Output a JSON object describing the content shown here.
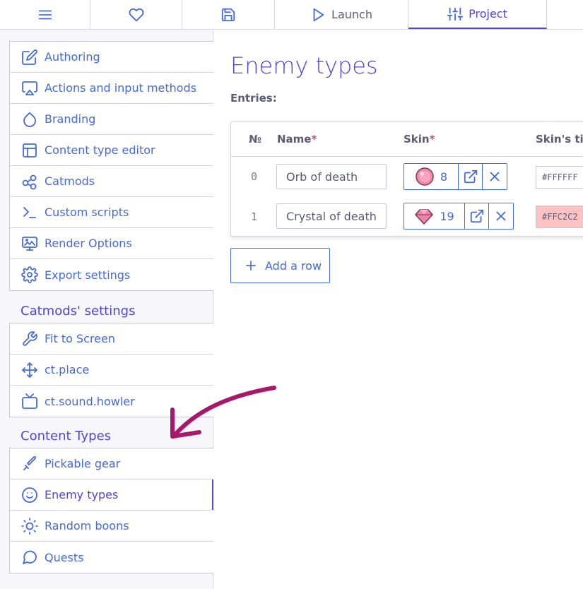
{
  "topbar": {
    "menu_icon": "menu-icon",
    "heart_icon": "heart-icon",
    "save_icon": "save-icon",
    "launch_label": "Launch",
    "project_label": "Project"
  },
  "sidebar": {
    "project_items": [
      {
        "label": "Authoring",
        "icon": "edit-icon"
      },
      {
        "label": "Actions and input methods",
        "icon": "airplay-icon"
      },
      {
        "label": "Branding",
        "icon": "droplet-icon"
      },
      {
        "label": "Content type editor",
        "icon": "layout-icon"
      },
      {
        "label": "Catmods",
        "icon": "modules-icon"
      },
      {
        "label": "Custom scripts",
        "icon": "terminal-icon"
      },
      {
        "label": "Render Options",
        "icon": "monitor-image-icon"
      },
      {
        "label": "Export settings",
        "icon": "settings-icon"
      }
    ],
    "catmods_title": "Catmods' settings",
    "catmod_items": [
      {
        "label": "Fit to Screen",
        "icon": "wrench-icon"
      },
      {
        "label": "ct.place",
        "icon": "move-icon"
      },
      {
        "label": "ct.sound.howler",
        "icon": "tv-icon"
      }
    ],
    "content_types_title": "Content Types",
    "content_type_items": [
      {
        "label": "Pickable gear",
        "icon": "sword-icon"
      },
      {
        "label": "Enemy types",
        "icon": "smile-icon",
        "active": true
      },
      {
        "label": "Random boons",
        "icon": "sun-icon"
      },
      {
        "label": "Quests",
        "icon": "message-circle-icon"
      }
    ]
  },
  "main": {
    "title": "Enemy types",
    "entries_label": "Entries:",
    "columns": {
      "num": "№",
      "name": "Name",
      "skin": "Skin",
      "tint": "Skin's tin",
      "required_mark": "*"
    },
    "rows": [
      {
        "index": "0",
        "name": "Orb of death",
        "skin_count": "8",
        "tint": "#FFFFFF",
        "tint_color": "#FFFFFF"
      },
      {
        "index": "1",
        "name": "Crystal of death",
        "skin_count": "19",
        "tint": "#FFC2C2",
        "tint_color": "#FFC2C2"
      }
    ],
    "add_row_label": "Add a row"
  },
  "colors": {
    "accent": "#446adb",
    "title": "#5144db",
    "required": "#d04a6a",
    "arrow": "#a8176a"
  }
}
